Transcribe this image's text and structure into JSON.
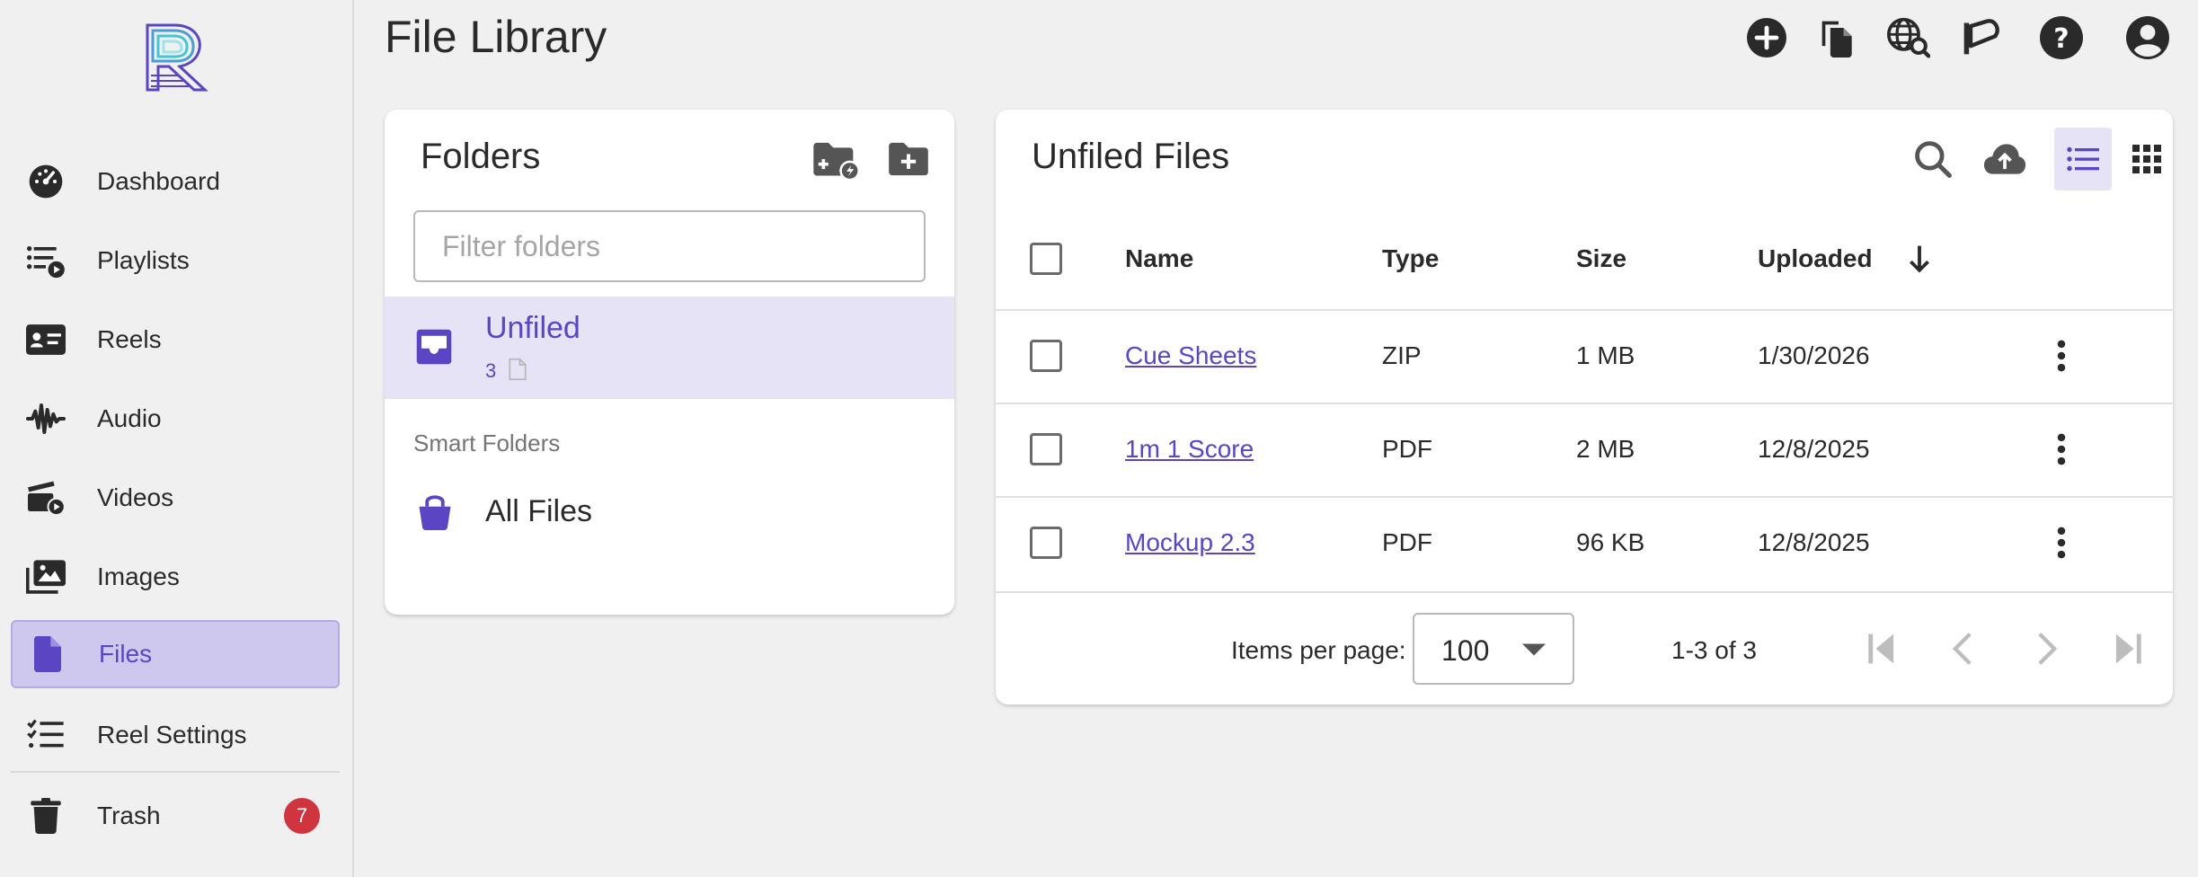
{
  "app": {
    "page_title": "File Library"
  },
  "sidebar": {
    "items": [
      {
        "label": "Dashboard",
        "icon": "dashboard-gauge-icon",
        "active": false
      },
      {
        "label": "Playlists",
        "icon": "playlist-play-icon",
        "active": false
      },
      {
        "label": "Reels",
        "icon": "id-card-icon",
        "active": false
      },
      {
        "label": "Audio",
        "icon": "audio-waveform-icon",
        "active": false
      },
      {
        "label": "Videos",
        "icon": "video-play-icon",
        "active": false
      },
      {
        "label": "Images",
        "icon": "images-icon",
        "active": false
      },
      {
        "label": "Files",
        "icon": "file-icon",
        "active": true
      },
      {
        "label": "Reel Settings",
        "icon": "checklist-icon",
        "active": false
      },
      {
        "label": "Trash",
        "icon": "trash-icon",
        "active": false,
        "badge": "7"
      }
    ]
  },
  "header_icons": [
    "add-circle-icon",
    "copy-files-icon",
    "globe-search-icon",
    "megaphone-icon",
    "help-icon",
    "account-icon"
  ],
  "folders": {
    "title": "Folders",
    "filter_placeholder": "Filter folders",
    "filter_value": "",
    "unfiled": {
      "label": "Unfiled",
      "count": "3"
    },
    "smart_folders_label": "Smart Folders",
    "all_files": {
      "label": "All Files"
    }
  },
  "files": {
    "title": "Unfiled Files",
    "columns": {
      "name": "Name",
      "type": "Type",
      "size": "Size",
      "uploaded": "Uploaded"
    },
    "rows": [
      {
        "name": "Cue Sheets",
        "type": "ZIP",
        "size": "1 MB",
        "uploaded": "1/30/2026"
      },
      {
        "name": "1m 1 Score",
        "type": "PDF",
        "size": "2 MB",
        "uploaded": "12/8/2025"
      },
      {
        "name": "Mockup 2.3",
        "type": "PDF",
        "size": "96 KB",
        "uploaded": "12/8/2025"
      }
    ],
    "pager": {
      "items_per_page_label": "Items per page:",
      "items_per_page_value": "100",
      "range": "1-3 of 3"
    }
  },
  "colors": {
    "accent": "#5b45c2",
    "active_nav_bg": "#cfc8ee",
    "selected_row_bg": "#e6e3f6",
    "badge": "#d0343f",
    "background": "#f0f0f0"
  }
}
